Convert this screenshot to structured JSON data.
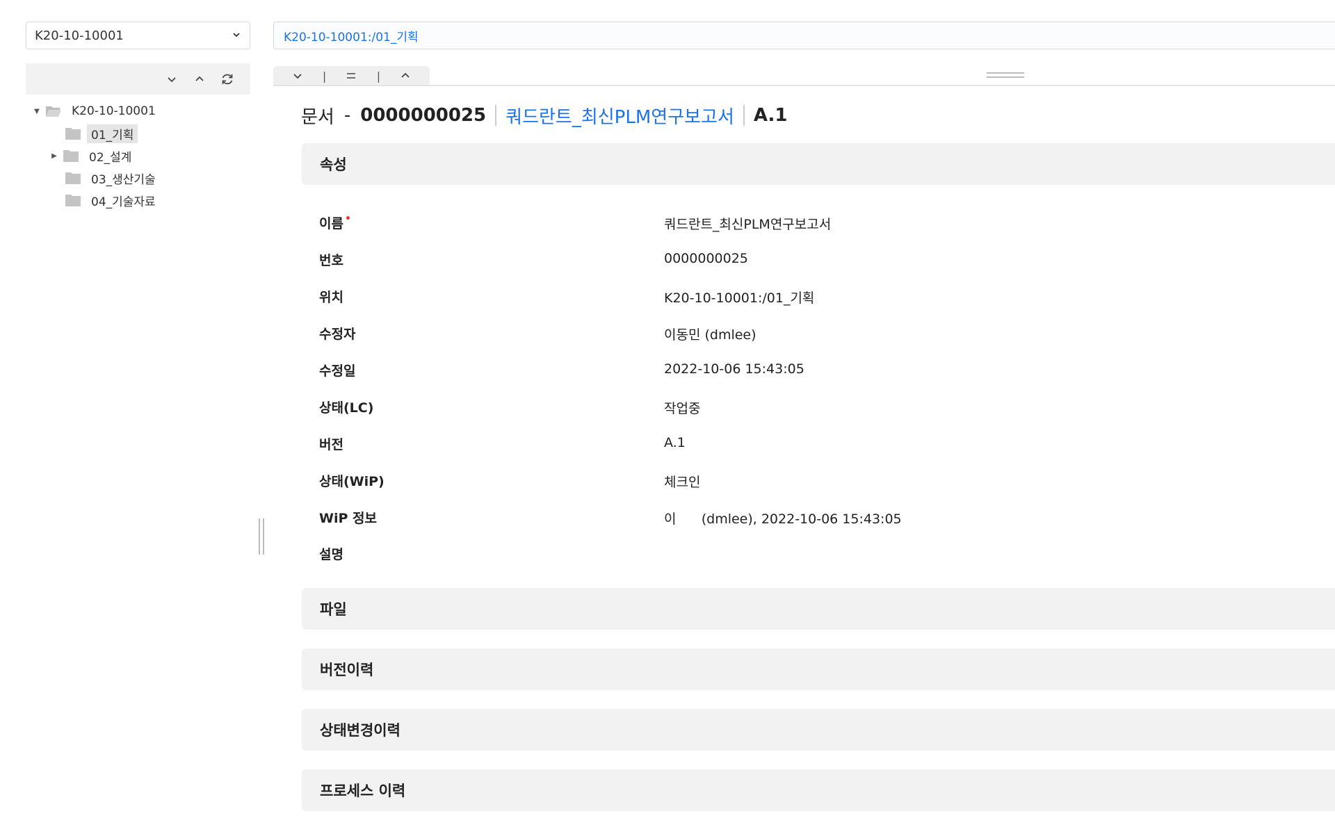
{
  "project_select": {
    "value": "K20-10-10001"
  },
  "path_bar": {
    "value": "K20-10-10001:/01_기획"
  },
  "tree": {
    "root": "K20-10-10001",
    "items": [
      {
        "label": "01_기획",
        "selected": true
      },
      {
        "label": "02_설계",
        "expandable": true
      },
      {
        "label": "03_생산기술"
      },
      {
        "label": "04_기술자료"
      }
    ]
  },
  "view_toolbar": {
    "separator": "|"
  },
  "header": {
    "type_label": "문서",
    "dash": "-",
    "number": "0000000025",
    "name": "쿼드란트_최신PLM연구보고서",
    "revision": "A.1"
  },
  "sections": {
    "properties": "속성",
    "files": "파일",
    "version_history": "버전이력",
    "state_history": "상태변경이력",
    "process_history": "프로세스 이력"
  },
  "attributes": [
    {
      "label": "이름",
      "value": "쿼드란트_최신PLM연구보고서",
      "required": "•"
    },
    {
      "label": "번호",
      "value": "0000000025"
    },
    {
      "label": "위치",
      "value": "K20-10-10001:/01_기획"
    },
    {
      "label": "수정자",
      "value": "이동민 (dmlee)"
    },
    {
      "label": "수정일",
      "value": "2022-10-06 15:43:05"
    },
    {
      "label": "상태(LC)",
      "value": "작업중"
    },
    {
      "label": "버전",
      "value": "A.1"
    },
    {
      "label": "상태(WiP)",
      "value": "체크인"
    },
    {
      "label": "WiP 정보",
      "value": "이      (dmlee), 2022-10-06 15:43:05"
    },
    {
      "label": "설명",
      "value": ""
    }
  ],
  "colors": {
    "accent": "#1a73e8",
    "required": "#e53935",
    "panel": "#f2f2f2"
  }
}
